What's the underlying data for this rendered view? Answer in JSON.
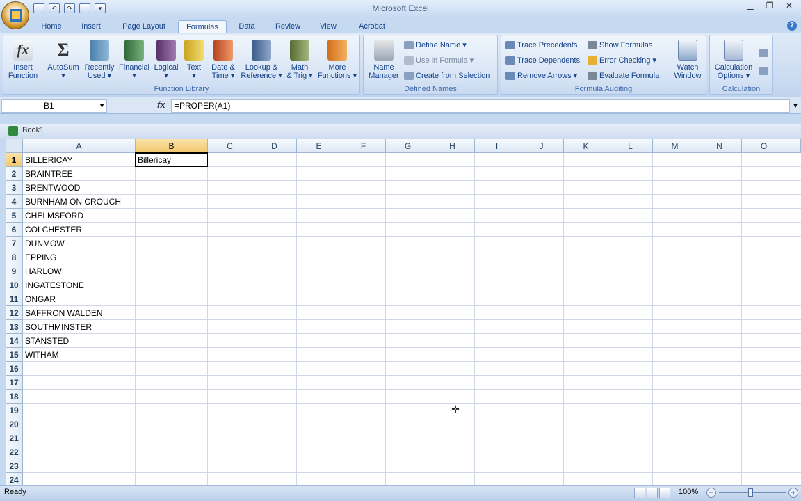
{
  "app": {
    "title": "Microsoft Excel"
  },
  "tabs": [
    "Home",
    "Insert",
    "Page Layout",
    "Formulas",
    "Data",
    "Review",
    "View",
    "Acrobat"
  ],
  "ribbon": {
    "function_library": {
      "label": "Function Library",
      "buttons": [
        {
          "l1": "Insert",
          "l2": "Function"
        },
        {
          "l1": "AutoSum",
          "l2": "▾"
        },
        {
          "l1": "Recently",
          "l2": "Used ▾"
        },
        {
          "l1": "Financial",
          "l2": "▾"
        },
        {
          "l1": "Logical",
          "l2": "▾"
        },
        {
          "l1": "Text",
          "l2": "▾"
        },
        {
          "l1": "Date &",
          "l2": "Time ▾"
        },
        {
          "l1": "Lookup &",
          "l2": "Reference ▾"
        },
        {
          "l1": "Math",
          "l2": "& Trig ▾"
        },
        {
          "l1": "More",
          "l2": "Functions ▾"
        }
      ]
    },
    "defined_names": {
      "label": "Defined Names",
      "name_manager": {
        "l1": "Name",
        "l2": "Manager"
      },
      "define_name": "Define Name ▾",
      "use_in_formula": "Use in Formula ▾",
      "create_from_selection": "Create from Selection"
    },
    "formula_auditing": {
      "label": "Formula Auditing",
      "trace_precedents": "Trace Precedents",
      "trace_dependents": "Trace Dependents",
      "remove_arrows": "Remove Arrows ▾",
      "show_formulas": "Show Formulas",
      "error_checking": "Error Checking ▾",
      "evaluate_formula": "Evaluate Formula",
      "watch_window": {
        "l1": "Watch",
        "l2": "Window"
      }
    },
    "calculation": {
      "label": "Calculation",
      "options": {
        "l1": "Calculation",
        "l2": "Options ▾"
      }
    }
  },
  "formula_bar": {
    "name_box": "B1",
    "fx": "fx",
    "formula": "=PROPER(A1)"
  },
  "workbook": {
    "name": "Book1"
  },
  "columns": [
    "A",
    "B",
    "C",
    "D",
    "E",
    "F",
    "G",
    "H",
    "I",
    "J",
    "K",
    "L",
    "M",
    "N",
    "O"
  ],
  "rows": [
    "1",
    "2",
    "3",
    "4",
    "5",
    "6",
    "7",
    "8",
    "9",
    "10",
    "11",
    "12",
    "13",
    "14",
    "15",
    "16",
    "17",
    "18",
    "19",
    "20",
    "21",
    "22",
    "23",
    "24"
  ],
  "cells": {
    "A": [
      "BILLERICAY",
      "BRAINTREE",
      "BRENTWOOD",
      "BURNHAM ON CROUCH",
      "CHELMSFORD",
      "COLCHESTER",
      "DUNMOW",
      "EPPING",
      "HARLOW",
      "INGATESTONE",
      "ONGAR",
      "SAFFRON WALDEN",
      "SOUTHMINSTER",
      "STANSTED",
      "WITHAM"
    ],
    "B": [
      "Billericay"
    ]
  },
  "selected_cell": "B1",
  "status": {
    "text": "Ready",
    "zoom": "100%"
  }
}
